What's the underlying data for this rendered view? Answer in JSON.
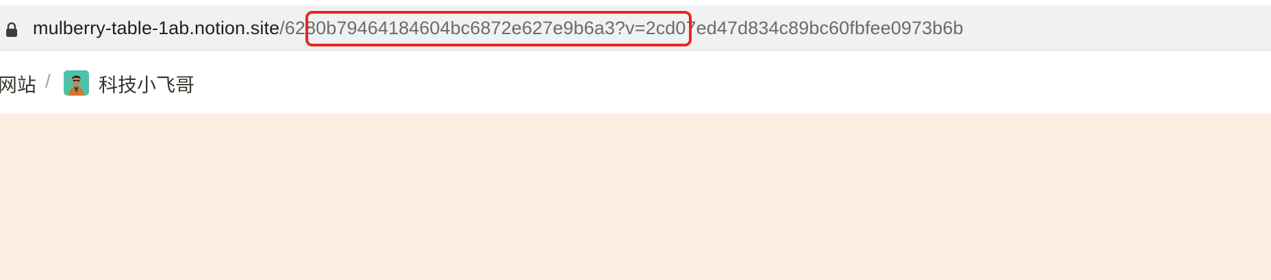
{
  "address_bar": {
    "url_host": "mulberry-table-1ab.notion.site",
    "url_path": "/6280b79464184604bc6872e627e9b6a3",
    "url_query": "?v=2cd07ed47d834c89bc60fbfee0973b6b"
  },
  "breadcrumb": {
    "previous_label": ".网站",
    "separator": "/",
    "current_label": "科技小飞哥"
  },
  "colors": {
    "highlight": "#e8271d",
    "cover": "#fdece0",
    "avatar_bg": "#4cc3a8"
  }
}
